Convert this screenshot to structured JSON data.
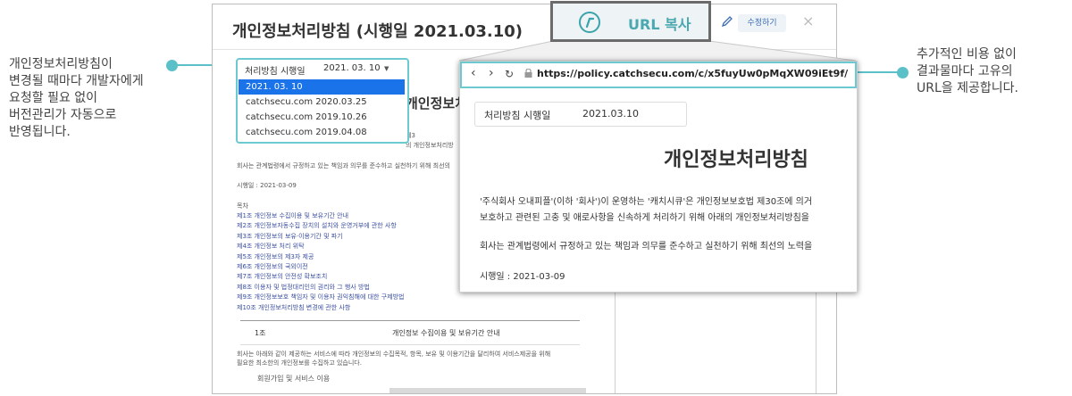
{
  "annotations": {
    "left": "개인정보처리방침이\n변경될 때마다 개발자에게\n요청할 필요 없이\n버전관리가 자동으로\n반영됩니다.",
    "right": "추가적인 비용 없이\n결과물마다 고유의\nURL을 제공합니다."
  },
  "colors": {
    "accent": "#5bc0c8",
    "select_blue": "#1a73e8"
  },
  "doc": {
    "title": "개인정보처리방침 (시행일 2021.03.10)",
    "edit_label": "수정하기",
    "close_label": "×",
    "dropdown": {
      "label": "처리방침 시행일",
      "value": "2021. 03. 10",
      "options": [
        "2021. 03. 10",
        "catchsecu.com 2020.03.25",
        "catchsecu.com 2019.10.26",
        "catchsecu.com 2019.04.08"
      ]
    },
    "bg_heading": "개인정보처리방",
    "bg_line1": "제3",
    "bg_line2": "의 개인정보처리방",
    "bg_intro": "회사는 관계법령에서 규정하고 있는 책임과 의무를 준수하고 실천하기 위해 최선의",
    "effective": "시행일 : 2021-03-09",
    "toc_title": "목차",
    "toc": [
      "제1조 개인정보 수집이용 및 보유기간 안내",
      "제2조 개인정보자동수집 장치의 설치와 운영거부에 관한 사항",
      "제3조 개인정보의 보유·이용기간 및 파기",
      "제4조 개인정보 처리 위탁",
      "제5조 개인정보의 제3자 제공",
      "제6조 개인정보의 국외이전",
      "제7조 개인정보의 안전성 확보조치",
      "제8조 이용자 및 법정대리인의 권리와 그 행사 방법",
      "제9조 개인정보보호 책임자 및 이용자 권익침해에 대한 구제방법",
      "제10조 개인정보처리방침 변경에 관한 사항"
    ],
    "section_num": "1조",
    "section_title": "개인정보 수집이용 및 보유기간 안내",
    "para1": "회사는 아래와 같이 제공하는 서비스에 따라 개인정보의 수집목적, 항목, 보유 및 이용기간을 달리하여 서비스제공을 위해",
    "para2": "필요한 최소한의 개인정보를 수집하고 있습니다.",
    "subhead": "회원가입 및 서비스 이용"
  },
  "url_button": {
    "label": "URL 복사",
    "icon": "link-logo-icon"
  },
  "browser": {
    "url": "https://policy.catchsecu.com/c/x5fuyUw0pMqXW09iEt9f/",
    "date_label": "처리방침 시행일",
    "date_value": "2021.03.10",
    "title": "개인정보처리방침",
    "line1": "'주식회사 오내피플'(이하 '회사')이 운영하는 '캐치시큐'은 개인정보보호법 제30조에 의거",
    "line2": "보호하고 관련된 고충 및 애로사항을 신속하게 처리하기 위해 아래의 개인정보처리방침을",
    "line3": "회사는 관계법령에서 규정하고 있는 책임과 의무를 준수하고 실천하기 위해 최선의 노력을",
    "effective": "시행일 : 2021-03-09"
  }
}
